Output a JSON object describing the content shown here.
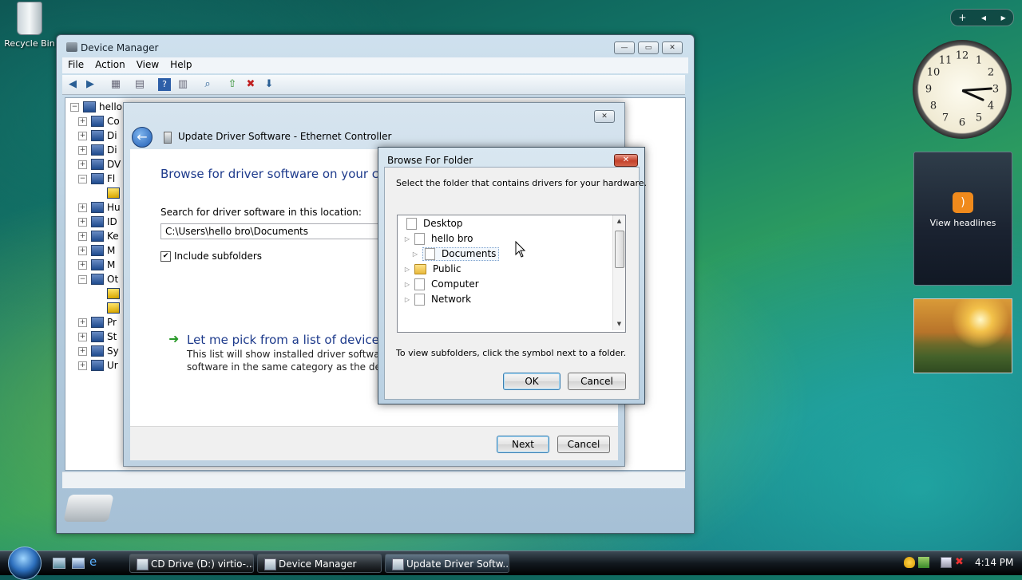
{
  "desktop": {
    "recycle_bin_label": "Recycle Bin"
  },
  "sidebar": {
    "add_label": "+",
    "prev_label": "◂",
    "next_label": "▸",
    "clock_numbers": [
      "12",
      "1",
      "2",
      "3",
      "4",
      "5",
      "6",
      "7",
      "8",
      "9",
      "10",
      "11"
    ],
    "feed_label": "View headlines"
  },
  "device_manager": {
    "title": "Device Manager",
    "menu": [
      "File",
      "Action",
      "View",
      "Help"
    ],
    "tree": [
      {
        "label": "hellob",
        "expander": "−"
      },
      {
        "label": "Co",
        "expander": "+"
      },
      {
        "label": "Di",
        "expander": "+"
      },
      {
        "label": "Di",
        "expander": "+"
      },
      {
        "label": "DV",
        "expander": "+"
      },
      {
        "label": "Fl",
        "expander": "−"
      },
      {
        "label": "",
        "expander": ""
      },
      {
        "label": "Hu",
        "expander": "+"
      },
      {
        "label": "ID",
        "expander": "+"
      },
      {
        "label": "Ke",
        "expander": "+"
      },
      {
        "label": "M",
        "expander": "+"
      },
      {
        "label": "M",
        "expander": "+"
      },
      {
        "label": "Ot",
        "expander": "−"
      },
      {
        "label": "",
        "expander": ""
      },
      {
        "label": "",
        "expander": ""
      },
      {
        "label": "Pr",
        "expander": "+"
      },
      {
        "label": "St",
        "expander": "+"
      },
      {
        "label": "Sy",
        "expander": "+"
      },
      {
        "label": "Ur",
        "expander": "+"
      }
    ]
  },
  "wizard": {
    "title": "Update Driver Software - Ethernet Controller",
    "heading": "Browse for driver software on your com",
    "search_label": "Search for driver software in this location:",
    "path_value": "C:\\Users\\hello bro\\Documents",
    "include_subfolders_label": "Include subfolders",
    "include_subfolders_checked": "✔",
    "pick_title": "Let me pick from a list of device dri",
    "pick_desc_line1": "This list will show installed driver software co",
    "pick_desc_line2": "software in the same category as the device.",
    "next_label": "Next",
    "cancel_label": "Cancel",
    "close_glyph": "✕"
  },
  "browse_dialog": {
    "title": "Browse For Folder",
    "instruction": "Select the folder that contains drivers for your hardware.",
    "items": [
      {
        "label": "Desktop",
        "arrow": ""
      },
      {
        "label": "hello bro",
        "arrow": "▷"
      },
      {
        "label": "Documents",
        "arrow": "▷"
      },
      {
        "label": "Public",
        "arrow": "▷"
      },
      {
        "label": "Computer",
        "arrow": "▷"
      },
      {
        "label": "Network",
        "arrow": "▷"
      }
    ],
    "selected_item": "Documents",
    "hint": "To view subfolders, click the symbol next to a folder.",
    "ok_label": "OK",
    "cancel_label": "Cancel",
    "close_glyph": "✕",
    "scroll_up": "▲",
    "scroll_down": "▼"
  },
  "taskbar": {
    "buttons": [
      {
        "label": "CD Drive (D:) virtio-...",
        "active": false
      },
      {
        "label": "Device Manager",
        "active": false
      },
      {
        "label": "Update Driver Softw...",
        "active": true
      }
    ],
    "clock": "4:14 PM"
  }
}
